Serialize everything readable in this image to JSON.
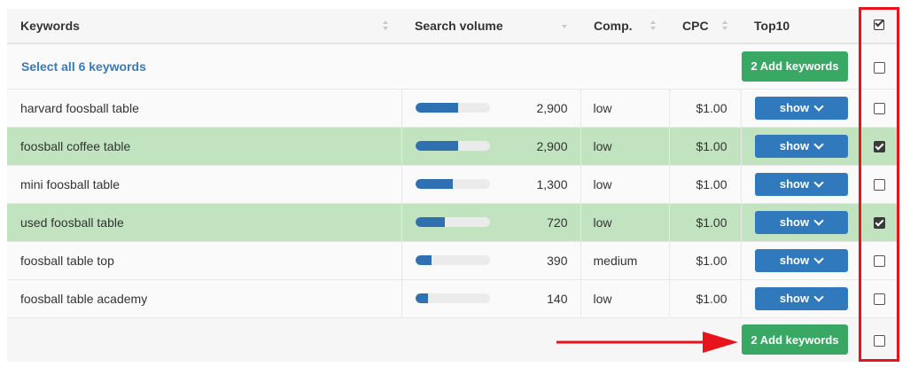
{
  "header": {
    "keywords": "Keywords",
    "search_volume": "Search volume",
    "comp": "Comp.",
    "cpc": "CPC",
    "top10": "Top10",
    "select_icon": "checkbox-check-icon"
  },
  "select_all": "Select all 6 keywords",
  "add_button_top": "2 Add keywords",
  "add_button_bottom": "2 Add keywords",
  "show_label": "show",
  "rows": [
    {
      "keyword": "harvard foosball table",
      "volume": "2,900",
      "volume_fraction": 0.58,
      "comp": "low",
      "cpc": "$1.00",
      "checked": false
    },
    {
      "keyword": "foosball coffee table",
      "volume": "2,900",
      "volume_fraction": 0.58,
      "comp": "low",
      "cpc": "$1.00",
      "checked": true
    },
    {
      "keyword": "mini foosball table",
      "volume": "1,300",
      "volume_fraction": 0.5,
      "comp": "low",
      "cpc": "$1.00",
      "checked": false
    },
    {
      "keyword": "used foosball table",
      "volume": "720",
      "volume_fraction": 0.4,
      "comp": "low",
      "cpc": "$1.00",
      "checked": true
    },
    {
      "keyword": "foosball table top",
      "volume": "390",
      "volume_fraction": 0.22,
      "comp": "medium",
      "cpc": "$1.00",
      "checked": false
    },
    {
      "keyword": "foosball table academy",
      "volume": "140",
      "volume_fraction": 0.17,
      "comp": "low",
      "cpc": "$1.00",
      "checked": false
    }
  ],
  "colors": {
    "accent_blue": "#3179bd",
    "add_green": "#3aa865",
    "selected_row": "#c2e3c0",
    "highlight_red": "#e8141c"
  }
}
